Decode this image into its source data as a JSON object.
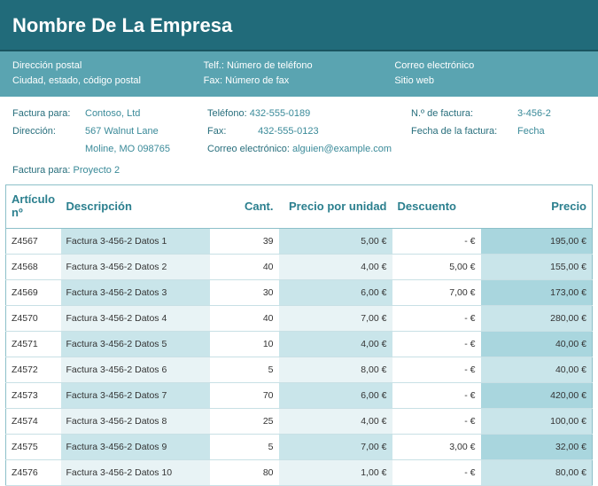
{
  "header": {
    "title": "Nombre De La Empresa",
    "address_line1": "Dirección postal",
    "address_line2": "Ciudad, estado, código postal",
    "phone": "Telf.: Número de teléfono",
    "fax": "Fax: Número de fax",
    "email": "Correo electrónico",
    "website": "Sitio web"
  },
  "bill": {
    "to_label": "Factura para:",
    "to_value": "Contoso, Ltd",
    "addr_label": "Dirección:",
    "addr_line1": "567 Walnut Lane",
    "addr_line2": "Moline, MO 098765",
    "phone_label": "Teléfono:",
    "phone_value": "432-555-0189",
    "fax_label": "Fax:",
    "fax_value": "432-555-0123",
    "email_label": "Correo electrónico:",
    "email_value": "alguien@example.com",
    "invoice_no_label": "N.º de factura:",
    "invoice_no_value": "3-456-2",
    "invoice_date_label": "Fecha de la factura:",
    "invoice_date_value": "Fecha"
  },
  "project": {
    "label": "Factura para:",
    "value": "Proyecto 2"
  },
  "table": {
    "headers": {
      "item": "Artículo nº",
      "desc": "Descripción",
      "qty": "Cant.",
      "unit": "Precio por unidad",
      "disc": "Descuento",
      "price": "Precio"
    },
    "rows": [
      {
        "item": "Z4567",
        "desc": "Factura 3-456-2 Datos 1",
        "qty": "39",
        "unit": "5,00 €",
        "disc": "-    €",
        "price": "195,00 €"
      },
      {
        "item": "Z4568",
        "desc": "Factura 3-456-2 Datos 2",
        "qty": "40",
        "unit": "4,00 €",
        "disc": "5,00 €",
        "price": "155,00 €"
      },
      {
        "item": "Z4569",
        "desc": "Factura 3-456-2 Datos 3",
        "qty": "30",
        "unit": "6,00 €",
        "disc": "7,00 €",
        "price": "173,00 €"
      },
      {
        "item": "Z4570",
        "desc": "Factura 3-456-2 Datos 4",
        "qty": "40",
        "unit": "7,00 €",
        "disc": "-    €",
        "price": "280,00 €"
      },
      {
        "item": "Z4571",
        "desc": "Factura 3-456-2 Datos 5",
        "qty": "10",
        "unit": "4,00 €",
        "disc": "-    €",
        "price": "40,00 €"
      },
      {
        "item": "Z4572",
        "desc": "Factura 3-456-2 Datos 6",
        "qty": "5",
        "unit": "8,00 €",
        "disc": "-    €",
        "price": "40,00 €"
      },
      {
        "item": "Z4573",
        "desc": "Factura 3-456-2 Datos 7",
        "qty": "70",
        "unit": "6,00 €",
        "disc": "-    €",
        "price": "420,00 €"
      },
      {
        "item": "Z4574",
        "desc": "Factura 3-456-2 Datos 8",
        "qty": "25",
        "unit": "4,00 €",
        "disc": "-    €",
        "price": "100,00 €"
      },
      {
        "item": "Z4575",
        "desc": "Factura 3-456-2 Datos 9",
        "qty": "5",
        "unit": "7,00 €",
        "disc": "3,00 €",
        "price": "32,00 €"
      },
      {
        "item": "Z4576",
        "desc": "Factura 3-456-2 Datos 10",
        "qty": "80",
        "unit": "1,00 €",
        "disc": "-    €",
        "price": "80,00 €"
      }
    ]
  }
}
